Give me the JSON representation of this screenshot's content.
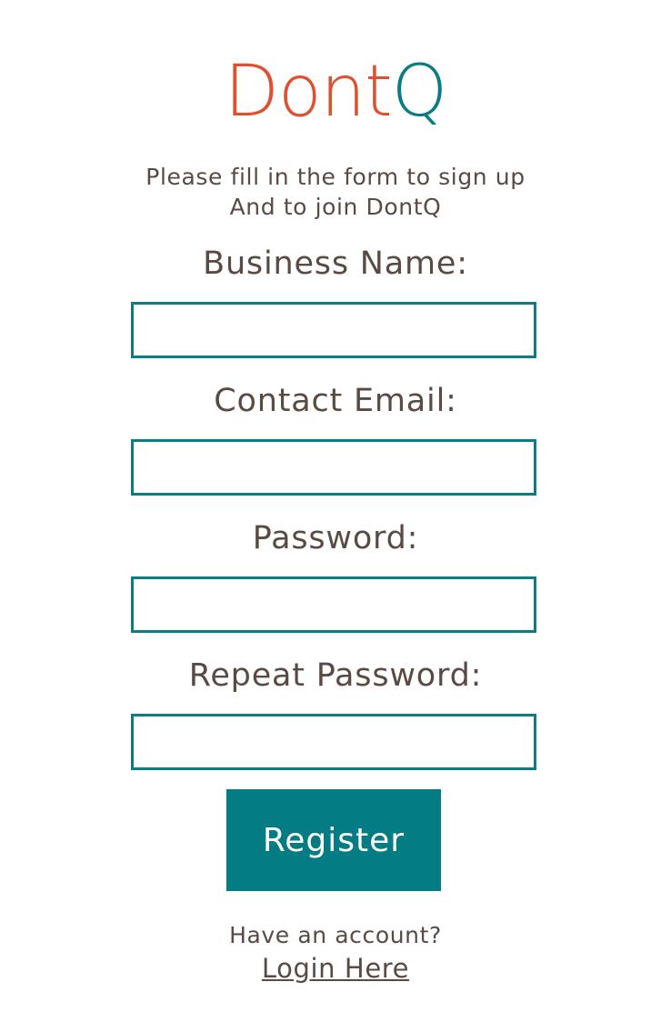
{
  "logo": {
    "part1": "Dont",
    "part2": "Q"
  },
  "intro": {
    "line1": "Please fill in the form to sign up",
    "line2": "And to join DontQ"
  },
  "form": {
    "business_name": {
      "label": "Business Name:",
      "value": ""
    },
    "contact_email": {
      "label": "Contact Email:",
      "value": ""
    },
    "password": {
      "label": "Password:",
      "value": ""
    },
    "repeat_password": {
      "label": "Repeat Password:",
      "value": ""
    },
    "submit_label": "Register"
  },
  "footer": {
    "prompt": "Have an account?",
    "login_link": "Login Here"
  },
  "colors": {
    "brand_orange": "#e0502f",
    "brand_teal": "#0b7c84",
    "text": "#5a4a44",
    "button_bg": "#047c84"
  }
}
